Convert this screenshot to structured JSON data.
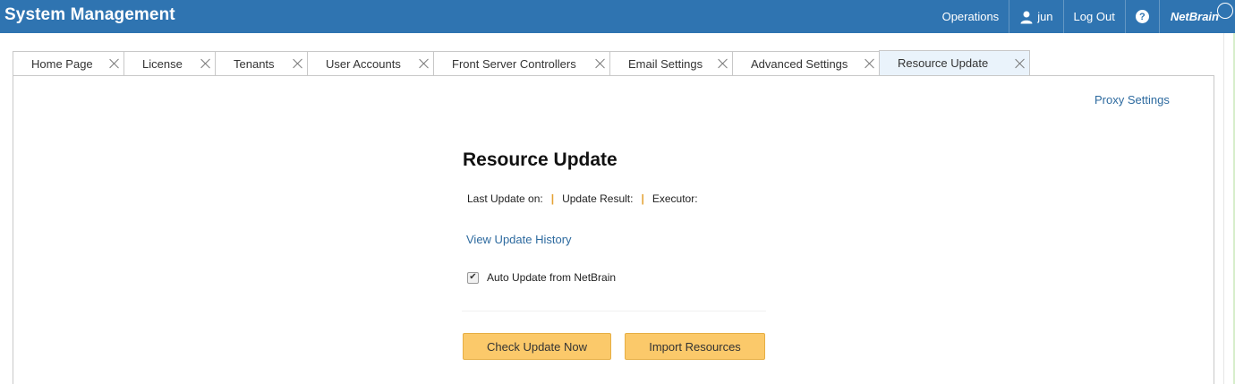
{
  "header": {
    "title": "System Management",
    "nav": {
      "operations": "Operations",
      "user": "jun",
      "logout": "Log Out",
      "help": "?",
      "logo": "NetBrain"
    }
  },
  "tabs": [
    {
      "label": "Home Page"
    },
    {
      "label": "License"
    },
    {
      "label": "Tenants"
    },
    {
      "label": "User Accounts"
    },
    {
      "label": "Front Server Controllers"
    },
    {
      "label": "Email Settings"
    },
    {
      "label": "Advanced Settings"
    },
    {
      "label": "Resource Update",
      "active": true
    }
  ],
  "content": {
    "proxy_link": "Proxy Settings",
    "title": "Resource Update",
    "last_update_label": "Last Update on:",
    "separator": "|",
    "update_result_label": "Update Result:",
    "executor_label": "Executor:",
    "history_link": "View Update History",
    "auto_update_label": "Auto Update from NetBrain",
    "auto_update_checked": true,
    "check_button": "Check Update Now",
    "import_button": "Import Resources"
  },
  "colors": {
    "header_bg": "#2f74b1",
    "link": "#2d6a9f",
    "button_bg": "#fbc96a",
    "separator": "#e4a234",
    "active_tab_bg": "#eaf3fb"
  }
}
